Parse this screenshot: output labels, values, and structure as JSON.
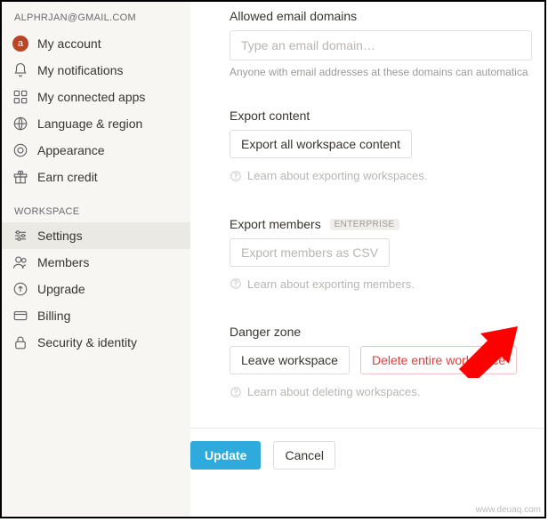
{
  "account": {
    "email": "ALPHRJAN@GMAIL.COM",
    "avatar_initial": "a"
  },
  "sidebar": {
    "items": [
      {
        "label": "My account"
      },
      {
        "label": "My notifications"
      },
      {
        "label": "My connected apps"
      },
      {
        "label": "Language & region"
      },
      {
        "label": "Appearance"
      },
      {
        "label": "Earn credit"
      }
    ],
    "workspace_header": "WORKSPACE",
    "workspace_items": [
      {
        "label": "Settings"
      },
      {
        "label": "Members"
      },
      {
        "label": "Upgrade"
      },
      {
        "label": "Billing"
      },
      {
        "label": "Security & identity"
      }
    ]
  },
  "main": {
    "allowed_domains": {
      "title": "Allowed email domains",
      "placeholder": "Type an email domain…",
      "helper": "Anyone with email addresses at these domains can automatically jo"
    },
    "export_content": {
      "title": "Export content",
      "button": "Export all workspace content",
      "learn": "Learn about exporting workspaces."
    },
    "export_members": {
      "title": "Export members",
      "badge": "ENTERPRISE",
      "button": "Export members as CSV",
      "learn": "Learn about exporting members."
    },
    "danger": {
      "title": "Danger zone",
      "leave": "Leave workspace",
      "delete": "Delete entire workspace",
      "learn": "Learn about deleting workspaces."
    },
    "footer": {
      "update": "Update",
      "cancel": "Cancel"
    }
  },
  "watermark": "www.deuaq.com"
}
